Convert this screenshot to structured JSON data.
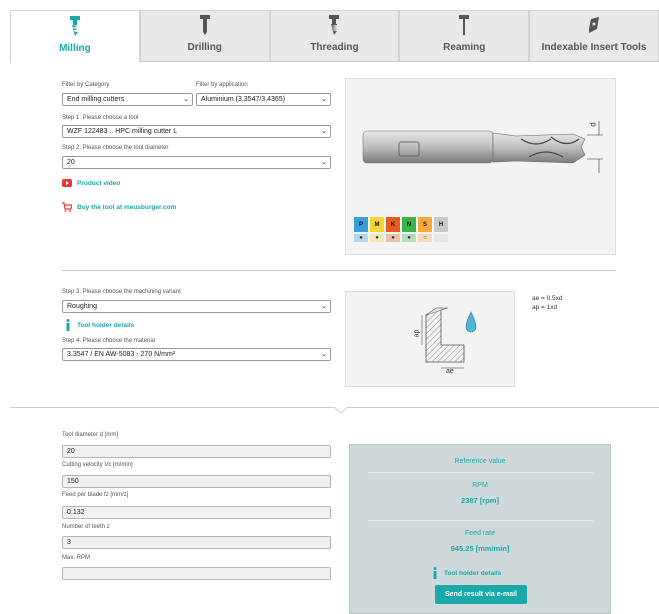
{
  "tabs": [
    {
      "label": "Milling",
      "active": true
    },
    {
      "label": "Drilling",
      "active": false
    },
    {
      "label": "Threading",
      "active": false
    },
    {
      "label": "Reaming",
      "active": false
    },
    {
      "label": "Indexable Insert Tools",
      "active": false
    }
  ],
  "filters": {
    "category_label": "Filter by Category",
    "category_value": "End milling cutters",
    "application_label": "Filter by application",
    "application_value": "Aluminium (3.3547/3.4365)"
  },
  "step1": {
    "label": "Step 1: Please choose a tool",
    "value": "WZF 122483 .. HPC milling cutter L"
  },
  "step2": {
    "label": "Step 2: Please choose the tool diameter",
    "value": "20"
  },
  "links": {
    "product_video": "Product video",
    "buy": "Buy the tool at meusburger.com",
    "holder1": "Tool holder details",
    "holder2": "Tool holder details"
  },
  "tool_image": {
    "dim_label": "d"
  },
  "materials": [
    {
      "code": "P",
      "color": "#3a9fd8",
      "mark": "●"
    },
    {
      "code": "M",
      "color": "#f5d33a",
      "mark": "●"
    },
    {
      "code": "K",
      "color": "#e85a1e",
      "mark": "●"
    },
    {
      "code": "N",
      "color": "#39b54a",
      "mark": "●"
    },
    {
      "code": "S",
      "color": "#f7a93b",
      "mark": "○"
    },
    {
      "code": "H",
      "color": "#c9c9c9",
      "mark": ""
    }
  ],
  "step3": {
    "label": "Step 3: Please choose the machining variant",
    "value": "Roughing"
  },
  "step4": {
    "label": "Step 4: Please choose the material",
    "value": "3.3547 / EN AW-5083 - 270 N/mm²"
  },
  "variant_image": {
    "ap_label": "ap",
    "ae_label": "ae",
    "note1": "ae = 0.5xd",
    "note2": "ap = 1xd"
  },
  "params": [
    {
      "label": "Tool diameter d [mm]",
      "value": "20"
    },
    {
      "label": "Cutting velocity Vc [m/min]",
      "value": "150"
    },
    {
      "label": "Feed per blade fz [mm/z]",
      "value": "0.132"
    },
    {
      "label": "Number of teeth z",
      "value": "3"
    },
    {
      "label": "Max. RPM",
      "value": ""
    }
  ],
  "result": {
    "title": "Reference value",
    "rpm_label": "RPM",
    "rpm_value": "2387 [rpm]",
    "feed_label": "Feed rate",
    "feed_value": "945.25 [mm/min]",
    "holder_link": "Tool holder details",
    "send_button": "Send result via e-mail"
  }
}
